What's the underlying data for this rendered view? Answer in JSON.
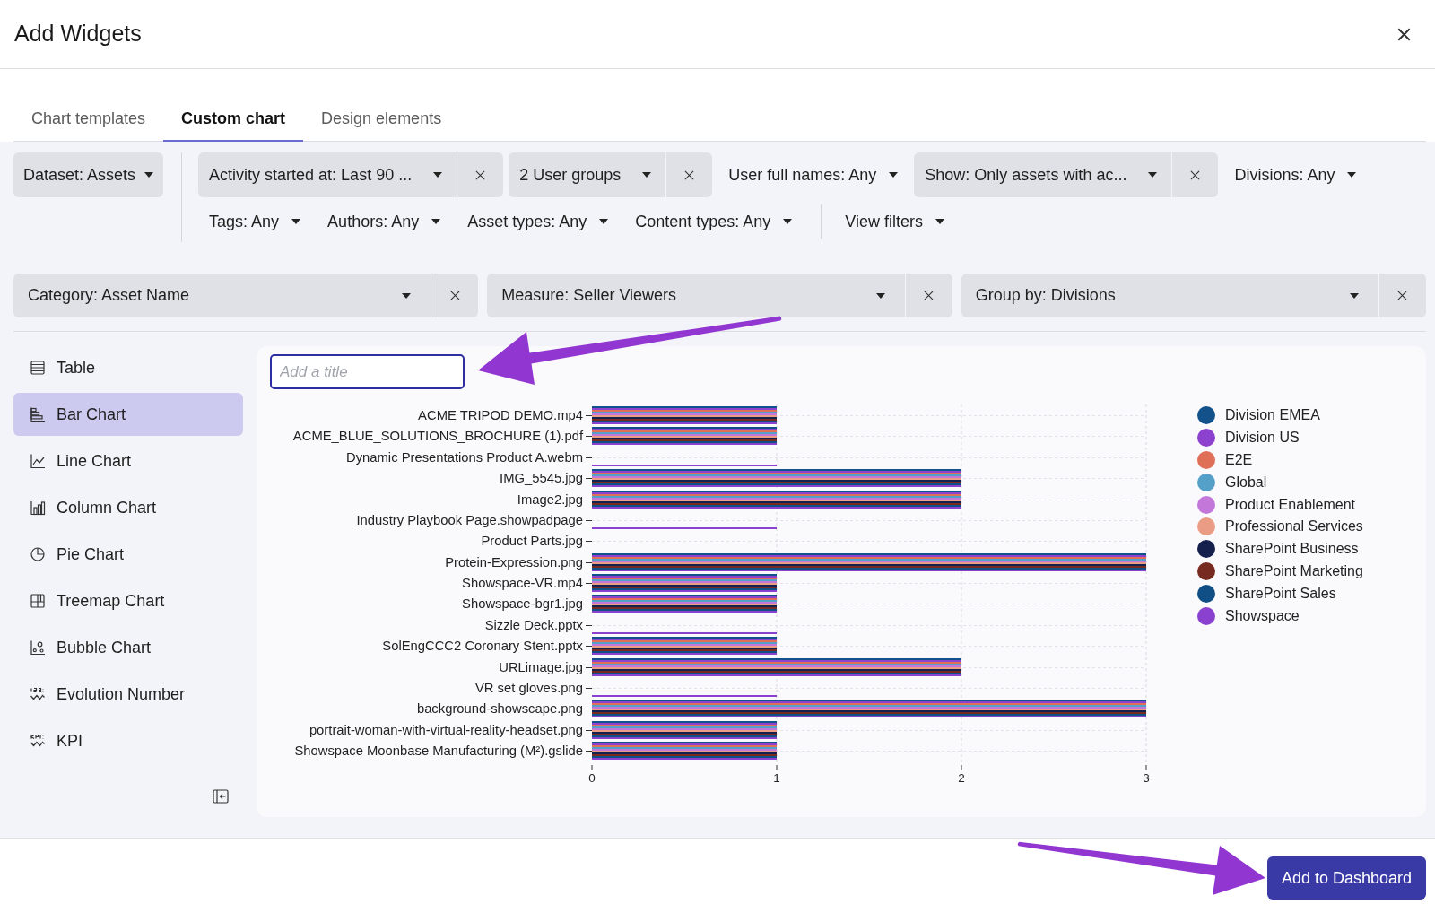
{
  "header": {
    "title": "Add Widgets"
  },
  "tabs": [
    {
      "label": "Chart templates",
      "selected": false
    },
    {
      "label": "Custom chart",
      "selected": true
    },
    {
      "label": "Design elements",
      "selected": false
    }
  ],
  "dataset": {
    "label": "Dataset: Assets"
  },
  "filter_rows": [
    [
      {
        "label": "Activity started at: Last 90 ...",
        "active": true
      },
      {
        "label": "2 User groups",
        "active": true
      },
      {
        "label": "User full names: Any",
        "active": false
      },
      {
        "label": "Show: Only assets with ac...",
        "active": true
      },
      {
        "label": "Divisions: Any",
        "active": false
      }
    ],
    [
      {
        "label": "Tags: Any",
        "active": false
      },
      {
        "label": "Authors: Any",
        "active": false
      },
      {
        "label": "Asset types: Any",
        "active": false
      },
      {
        "label": "Content types: Any",
        "active": false
      }
    ]
  ],
  "view_filters": {
    "label": "View filters"
  },
  "chart_config": [
    {
      "label": "Category: Asset Name"
    },
    {
      "label": "Measure: Seller Viewers"
    },
    {
      "label": "Group by: Divisions"
    }
  ],
  "sidebar": {
    "items": [
      {
        "label": "Table",
        "kind": "table",
        "selected": false
      },
      {
        "label": "Bar Chart",
        "kind": "bar",
        "selected": true
      },
      {
        "label": "Line Chart",
        "kind": "line",
        "selected": false
      },
      {
        "label": "Column Chart",
        "kind": "column",
        "selected": false
      },
      {
        "label": "Pie Chart",
        "kind": "pie",
        "selected": false
      },
      {
        "label": "Treemap Chart",
        "kind": "treemap",
        "selected": false
      },
      {
        "label": "Bubble Chart",
        "kind": "bubble",
        "selected": false
      },
      {
        "label": "Evolution Number",
        "kind": "evolution",
        "selected": false
      },
      {
        "label": "KPI",
        "kind": "kpi",
        "selected": false
      }
    ]
  },
  "chart": {
    "title_input": {
      "placeholder": "Add a title",
      "focused": true
    },
    "chart_data": {
      "type": "bar",
      "orientation": "horizontal",
      "grid": true,
      "legend": "right",
      "xlim": [
        0,
        3
      ],
      "xticks": [
        0,
        1,
        2,
        3
      ],
      "categories": [
        "ACME TRIPOD DEMO.mp4",
        "ACME_BLUE_SOLUTIONS_BROCHURE (1).pdf",
        "Dynamic Presentations Product A.webm",
        "IMG_5545.jpg",
        "Image2.jpg",
        "Industry Playbook Page.showpadpage",
        "Product Parts.jpg",
        "Protein-Expression.png",
        "Showspace-VR.mp4",
        "Showspace-bgr1.jpg",
        "Sizzle Deck.pptx",
        "SolEngCCC2 Coronary Stent.pptx",
        "URLimage.jpg",
        "VR set gloves.png",
        "background-showscape.png",
        "portrait-woman-with-virtual-reality-headset.png",
        "Showspace Moonbase Manufacturing (M²).gslide"
      ],
      "series": [
        {
          "name": "Division EMEA",
          "color": "#13518a",
          "values": [
            1,
            1,
            0,
            2,
            2,
            0,
            0,
            3,
            1,
            1,
            0,
            1,
            2,
            0,
            3,
            1,
            1
          ]
        },
        {
          "name": "Division US",
          "color": "#8c42cf",
          "values": [
            1,
            1,
            0,
            2,
            2,
            0,
            0,
            3,
            1,
            1,
            0,
            1,
            2,
            0,
            3,
            1,
            1
          ]
        },
        {
          "name": "E2E",
          "color": "#e06f57",
          "values": [
            1,
            1,
            0,
            2,
            2,
            0,
            0,
            3,
            1,
            1,
            0,
            1,
            2,
            0,
            3,
            1,
            1
          ]
        },
        {
          "name": "Global",
          "color": "#55a0c9",
          "values": [
            1,
            1,
            0,
            2,
            2,
            0,
            0,
            3,
            1,
            1,
            0,
            1,
            2,
            0,
            3,
            1,
            1
          ]
        },
        {
          "name": "Product Enablement",
          "color": "#c377d9",
          "values": [
            1,
            1,
            0,
            2,
            2,
            0,
            0,
            3,
            1,
            1,
            0,
            1,
            2,
            0,
            3,
            1,
            1
          ]
        },
        {
          "name": "Professional Services",
          "color": "#ea9c84",
          "values": [
            1,
            1,
            0,
            2,
            2,
            0,
            0,
            3,
            1,
            1,
            0,
            1,
            2,
            0,
            3,
            1,
            1
          ]
        },
        {
          "name": "SharePoint Business",
          "color": "#16204d",
          "values": [
            1,
            1,
            0,
            2,
            2,
            0,
            0,
            3,
            1,
            1,
            0,
            1,
            2,
            0,
            3,
            1,
            1
          ]
        },
        {
          "name": "SharePoint Marketing",
          "color": "#772b20",
          "values": [
            1,
            1,
            0,
            2,
            2,
            0,
            0,
            3,
            1,
            1,
            0,
            1,
            2,
            0,
            3,
            1,
            1
          ]
        },
        {
          "name": "SharePoint Sales",
          "color": "#0f4f86",
          "values": [
            1,
            1,
            0,
            2,
            2,
            0,
            0,
            3,
            1,
            1,
            0,
            1,
            2,
            0,
            3,
            1,
            1
          ]
        },
        {
          "name": "Showspace",
          "color": "#8a41cf",
          "values": [
            1,
            1,
            1,
            2,
            2,
            1,
            0,
            3,
            1,
            1,
            1,
            1,
            2,
            1,
            3,
            1,
            1
          ]
        }
      ]
    }
  },
  "footer": {
    "button": "Add to Dashboard"
  }
}
